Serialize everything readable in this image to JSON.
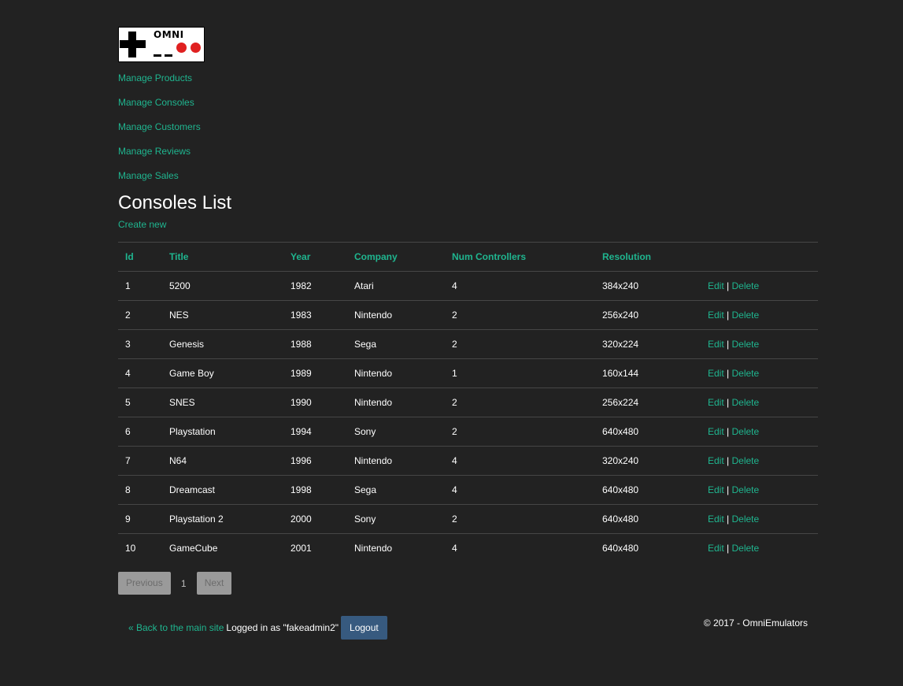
{
  "logo": {
    "text": "OMNI"
  },
  "nav": [
    "Manage Products",
    "Manage Consoles",
    "Manage Customers",
    "Manage Reviews",
    "Manage Sales"
  ],
  "page_title": "Consoles List",
  "create_label": "Create new",
  "table": {
    "headers": [
      "Id",
      "Title",
      "Year",
      "Company",
      "Num Controllers",
      "Resolution"
    ],
    "rows": [
      [
        "1",
        "5200",
        "1982",
        "Atari",
        "4",
        "384x240"
      ],
      [
        "2",
        "NES",
        "1983",
        "Nintendo",
        "2",
        "256x240"
      ],
      [
        "3",
        "Genesis",
        "1988",
        "Sega",
        "2",
        "320x224"
      ],
      [
        "4",
        "Game Boy",
        "1989",
        "Nintendo",
        "1",
        "160x144"
      ],
      [
        "5",
        "SNES",
        "1990",
        "Nintendo",
        "2",
        "256x224"
      ],
      [
        "6",
        "Playstation",
        "1994",
        "Sony",
        "2",
        "640x480"
      ],
      [
        "7",
        "N64",
        "1996",
        "Nintendo",
        "4",
        "320x240"
      ],
      [
        "8",
        "Dreamcast",
        "1998",
        "Sega",
        "4",
        "640x480"
      ],
      [
        "9",
        "Playstation 2",
        "2000",
        "Sony",
        "2",
        "640x480"
      ],
      [
        "10",
        "GameCube",
        "2001",
        "Nintendo",
        "4",
        "640x480"
      ]
    ],
    "edit_label": "Edit",
    "separator": "|",
    "delete_label": "Delete"
  },
  "pagination": {
    "previous": "Previous",
    "current": "1",
    "next": "Next"
  },
  "footer": {
    "back_link": "« Back to the main site",
    "logged_in": "Logged in as \"fakeadmin2\"",
    "logout": "Logout",
    "copyright": "© 2017 - OmniEmulators"
  },
  "colors": {
    "background": "#222222",
    "accent": "#1fb58f",
    "logout_button": "#375a7f"
  }
}
